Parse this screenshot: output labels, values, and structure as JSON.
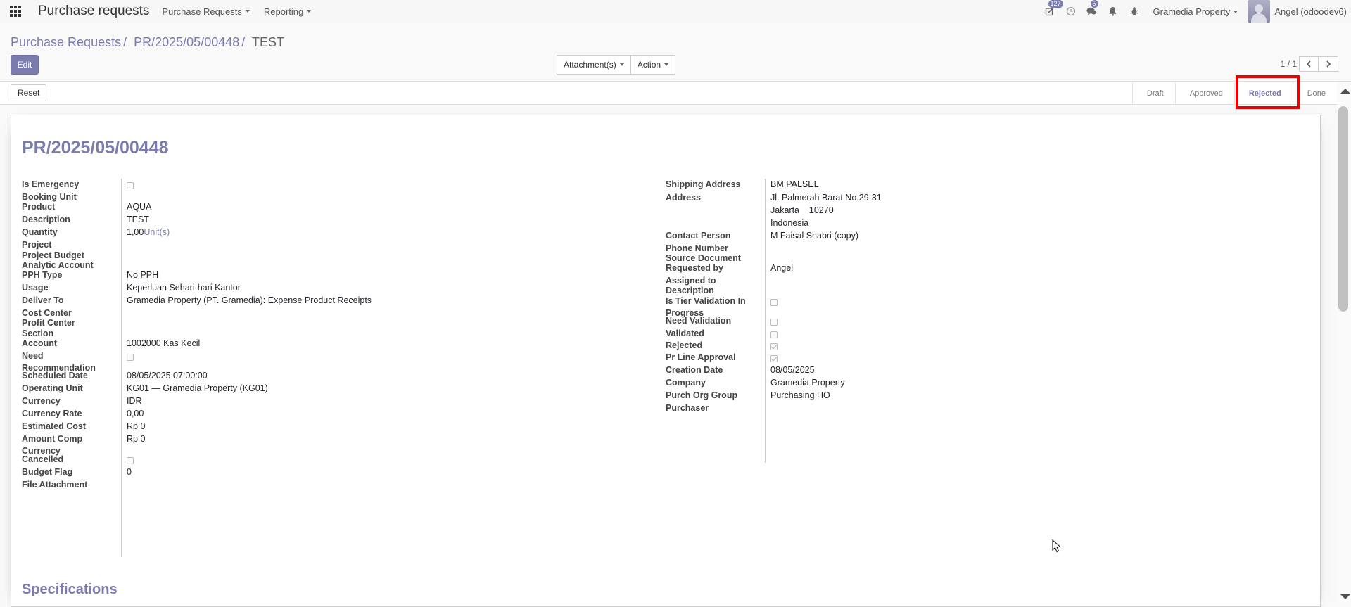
{
  "navbar": {
    "app_title": "Purchase requests",
    "menus": [
      {
        "label": "Purchase Requests"
      },
      {
        "label": "Reporting"
      }
    ],
    "activity_badge": "127",
    "chat_badge": "5",
    "company": "Gramedia Property",
    "user": "Angel (odoodev6)"
  },
  "breadcrumb": {
    "items": [
      "Purchase Requests",
      "PR/2025/05/00448"
    ],
    "current": "TEST"
  },
  "actions": {
    "edit": "Edit",
    "attachments": "Attachment(s)",
    "action": "Action",
    "pager": "1 / 1"
  },
  "statusbar": {
    "reset": "Reset",
    "steps": [
      "Draft",
      "Approved",
      "Rejected",
      "Done"
    ],
    "current_step": "Rejected"
  },
  "record": {
    "title": "PR/2025/05/00448",
    "left": {
      "is_emergency": {
        "label": "Is Emergency",
        "checked": false
      },
      "booking_unit": {
        "label": "Booking Unit"
      },
      "product": {
        "label": "Product",
        "value": "AQUA"
      },
      "description": {
        "label": "Description",
        "value": "TEST"
      },
      "quantity": {
        "label": "Quantity",
        "value": "1,00",
        "uom": "Unit(s)"
      },
      "project": {
        "label": "Project"
      },
      "project_budget": {
        "label": "Project Budget"
      },
      "analytic_account": {
        "label": "Analytic Account"
      },
      "pph_type": {
        "label": "PPH Type",
        "value": "No PPH"
      },
      "usage": {
        "label": "Usage",
        "value": "Keperluan Sehari-hari Kantor"
      },
      "deliver_to": {
        "label": "Deliver To",
        "value": "Gramedia Property (PT. Gramedia): Expense Product Receipts"
      },
      "cost_center": {
        "label": "Cost Center"
      },
      "profit_center": {
        "label": "Profit Center"
      },
      "section": {
        "label": "Section"
      },
      "account": {
        "label": "Account",
        "value": "1002000 Kas Kecil"
      },
      "need_recommendation": {
        "label": "Need Recommendation",
        "checked": false
      },
      "scheduled_date": {
        "label": "Scheduled Date",
        "value": "08/05/2025 07:00:00"
      },
      "operating_unit": {
        "label": "Operating Unit",
        "value": "KG01 — Gramedia Property (KG01)"
      },
      "currency": {
        "label": "Currency",
        "value": "IDR"
      },
      "currency_rate": {
        "label": "Currency Rate",
        "value": "0,00"
      },
      "estimated_cost": {
        "label": "Estimated Cost",
        "value": "Rp 0"
      },
      "amount_comp_currency": {
        "label": "Amount Comp Currency",
        "value": "Rp 0"
      },
      "cancelled": {
        "label": "Cancelled",
        "checked": false
      },
      "budget_flag": {
        "label": "Budget Flag",
        "value": "0"
      },
      "file_attachment": {
        "label": "File Attachment"
      }
    },
    "right": {
      "shipping_address": {
        "label": "Shipping Address",
        "value": "BM PALSEL"
      },
      "address": {
        "label": "Address",
        "line1": "Jl. Palmerah Barat No.29-31",
        "city": "Jakarta",
        "zip": "10270",
        "country": "Indonesia"
      },
      "contact_person": {
        "label": "Contact Person",
        "value": "M Faisal Shabri (copy)"
      },
      "phone_number": {
        "label": "Phone Number"
      },
      "source_document": {
        "label": "Source Document"
      },
      "requested_by": {
        "label": "Requested by",
        "value": "Angel"
      },
      "assigned_to": {
        "label": "Assigned to"
      },
      "description": {
        "label": "Description"
      },
      "tier_validation": {
        "label": "Is Tier Validation In Progress",
        "checked": false
      },
      "need_validation": {
        "label": "Need Validation",
        "checked": false
      },
      "validated": {
        "label": "Validated",
        "checked": false
      },
      "rejected": {
        "label": "Rejected",
        "checked": true
      },
      "pr_line_approval": {
        "label": "Pr Line Approval",
        "checked": true
      },
      "creation_date": {
        "label": "Creation Date",
        "value": "08/05/2025"
      },
      "company": {
        "label": "Company",
        "value": "Gramedia Property"
      },
      "purch_org_group": {
        "label": "Purch Org Group",
        "value": "Purchasing HO"
      },
      "purchaser": {
        "label": "Purchaser"
      }
    },
    "specifications_title": "Specifications"
  },
  "colors": {
    "primary": "#7c7bad",
    "highlight": "#ee0000"
  },
  "icons": [
    "apps-icon",
    "activity-icon",
    "clock-icon",
    "chat-icon",
    "bell-icon",
    "bug-icon",
    "chevron-left-icon",
    "chevron-right-icon",
    "cursor-icon"
  ]
}
